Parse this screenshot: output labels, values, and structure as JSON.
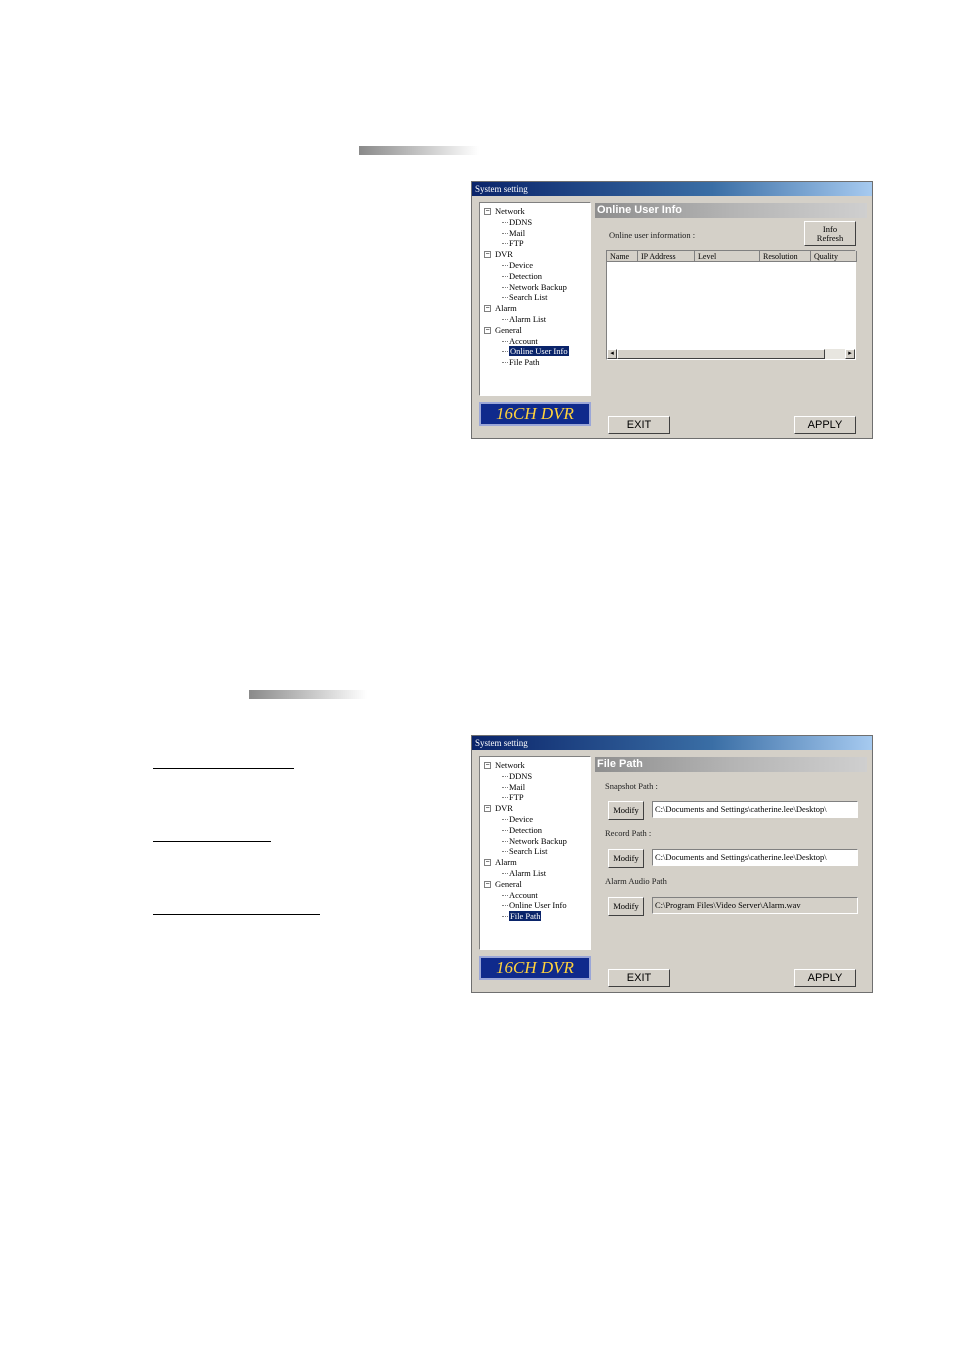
{
  "window1": {
    "title": "System setting",
    "logo": "16CH DVR",
    "tree": [
      {
        "label": "Network",
        "level": 0,
        "expander": "−"
      },
      {
        "label": "DDNS",
        "level": 1
      },
      {
        "label": "Mail",
        "level": 1
      },
      {
        "label": "FTP",
        "level": 1
      },
      {
        "label": "DVR",
        "level": 0,
        "expander": "−"
      },
      {
        "label": "Device",
        "level": 1
      },
      {
        "label": "Detection",
        "level": 1
      },
      {
        "label": "Network Backup",
        "level": 1
      },
      {
        "label": "Search List",
        "level": 1
      },
      {
        "label": "Alarm",
        "level": 0,
        "expander": "−"
      },
      {
        "label": "Alarm List",
        "level": 1
      },
      {
        "label": "General",
        "level": 0,
        "expander": "−"
      },
      {
        "label": "Account",
        "level": 1
      },
      {
        "label": "Online User Info",
        "level": 1,
        "selected": true
      },
      {
        "label": "File Path",
        "level": 1
      }
    ],
    "panel_title": "Online User Info",
    "online_label": "Online user information :",
    "refresh_line1": "Info",
    "refresh_line2": "Refresh",
    "columns": [
      "Name",
      "IP Address",
      "Level",
      "Resolution",
      "Quality"
    ],
    "scroll_left": "◂",
    "scroll_right": "▸",
    "exit_label": "EXIT",
    "apply_label": "APPLY"
  },
  "window2": {
    "title": "System setting",
    "logo": "16CH DVR",
    "tree": [
      {
        "label": "Network",
        "level": 0,
        "expander": "−"
      },
      {
        "label": "DDNS",
        "level": 1
      },
      {
        "label": "Mail",
        "level": 1
      },
      {
        "label": "FTP",
        "level": 1
      },
      {
        "label": "DVR",
        "level": 0,
        "expander": "−"
      },
      {
        "label": "Device",
        "level": 1
      },
      {
        "label": "Detection",
        "level": 1
      },
      {
        "label": "Network Backup",
        "level": 1
      },
      {
        "label": "Search List",
        "level": 1
      },
      {
        "label": "Alarm",
        "level": 0,
        "expander": "−"
      },
      {
        "label": "Alarm List",
        "level": 1
      },
      {
        "label": "General",
        "level": 0,
        "expander": "−"
      },
      {
        "label": "Account",
        "level": 1
      },
      {
        "label": "Online User Info",
        "level": 1
      },
      {
        "label": "File Path",
        "level": 1,
        "selected": true
      }
    ],
    "panel_title": "File Path",
    "snapshot_label": "Snapshot Path :",
    "record_label": "Record Path :",
    "alarm_audio_label": "Alarm Audio Path",
    "modify_label": "Modify",
    "snapshot_path": "C:\\Documents and Settings\\catherine.lee\\Desktop\\",
    "record_path": "C:\\Documents and Settings\\catherine.lee\\Desktop\\",
    "alarm_audio_path": "C:\\Program Files\\Video Server\\Alarm.wav",
    "exit_label": "EXIT",
    "apply_label": "APPLY"
  }
}
